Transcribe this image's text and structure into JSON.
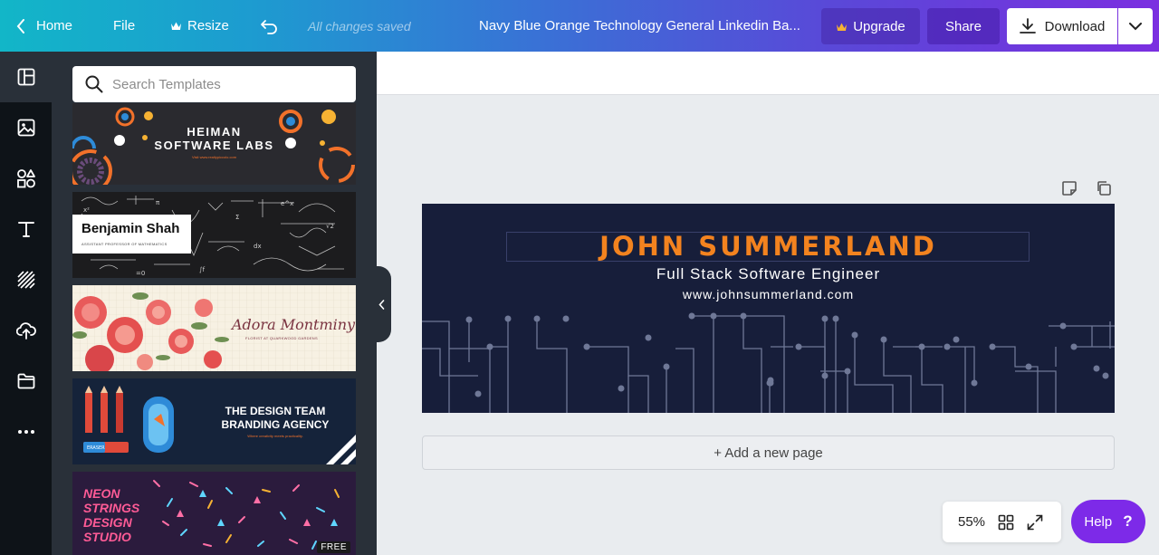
{
  "topbar": {
    "home_label": "Home",
    "file_label": "File",
    "resize_label": "Resize",
    "saved_status": "All changes saved",
    "doc_title": "Navy Blue Orange Technology General Linkedin Ba...",
    "upgrade_label": "Upgrade",
    "share_label": "Share",
    "download_label": "Download"
  },
  "rail": {
    "items": [
      {
        "icon": "templates-icon",
        "active": true
      },
      {
        "icon": "photos-icon"
      },
      {
        "icon": "elements-icon"
      },
      {
        "icon": "text-icon"
      },
      {
        "icon": "background-icon"
      },
      {
        "icon": "uploads-icon"
      },
      {
        "icon": "folder-icon"
      },
      {
        "icon": "more-icon"
      }
    ]
  },
  "panel": {
    "search_placeholder": "Search Templates",
    "templates": [
      {
        "title_line1": "HEIMAN",
        "title_line2": "SOFTWARE LABS",
        "subtitle": "Visit www.realtypiccolo.com"
      },
      {
        "title": "Benjamin Shah",
        "subtitle": "ASSISTANT PROFESSOR OF MATHEMATICS"
      },
      {
        "title": "Adora Montminy",
        "subtitle": "FLORIST AT QUARKWOOD GARDENS"
      },
      {
        "title_line1": "THE DESIGN TEAM",
        "title_line2": "BRANDING AGENCY",
        "subtitle": "Where creativity meets practicality.",
        "eraser_label": "ERASER"
      },
      {
        "title_lines": [
          "NEON",
          "STRINGS",
          "DESIGN",
          "STUDIO"
        ],
        "badge": "FREE"
      }
    ]
  },
  "design": {
    "name": "JOHN SUMMERLAND",
    "role": "Full Stack Software Engineer",
    "website": "www.johnsummerland.com"
  },
  "canvas": {
    "add_page_label": "+ Add a new page",
    "zoom": "55%",
    "help_label": "Help",
    "help_glyph": "?"
  },
  "colors": {
    "accent_purple": "#7d2ae8",
    "design_bg": "#171e3a",
    "design_name": "#f3831f"
  }
}
